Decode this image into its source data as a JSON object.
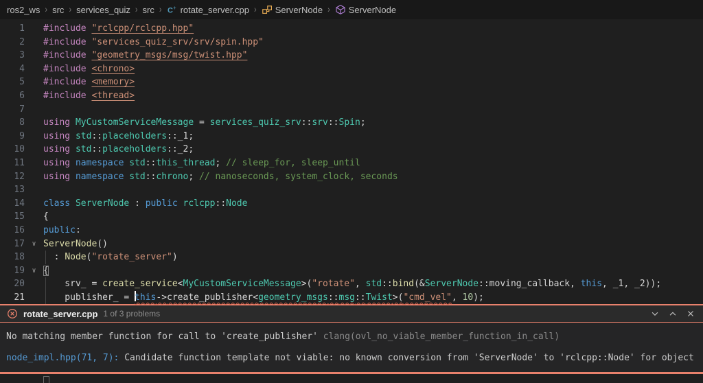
{
  "breadcrumb": {
    "items": [
      {
        "label": "ros2_ws"
      },
      {
        "label": "src"
      },
      {
        "label": "services_quiz"
      },
      {
        "label": "src"
      },
      {
        "label": "rotate_server.cpp",
        "icon": "cpp-file-icon"
      },
      {
        "label": "ServerNode",
        "icon": "class-icon"
      },
      {
        "label": "ServerNode",
        "icon": "method-icon"
      }
    ]
  },
  "editor": {
    "lines": [
      {
        "n": 1,
        "tokens": [
          [
            "pp",
            "#include"
          ],
          [
            "tx",
            " "
          ],
          [
            "st u",
            "\"rclcpp/rclcpp.hpp\""
          ]
        ]
      },
      {
        "n": 2,
        "tokens": [
          [
            "pp",
            "#include"
          ],
          [
            "tx",
            " "
          ],
          [
            "st",
            "\"services_quiz_srv/srv/spin.hpp\""
          ]
        ]
      },
      {
        "n": 3,
        "tokens": [
          [
            "pp",
            "#include"
          ],
          [
            "tx",
            " "
          ],
          [
            "st u",
            "\"geometry_msgs/msg/twist.hpp\""
          ]
        ]
      },
      {
        "n": 4,
        "tokens": [
          [
            "pp",
            "#include"
          ],
          [
            "tx",
            " "
          ],
          [
            "st u",
            "<chrono>"
          ]
        ]
      },
      {
        "n": 5,
        "tokens": [
          [
            "pp",
            "#include"
          ],
          [
            "tx",
            " "
          ],
          [
            "st u",
            "<memory>"
          ]
        ]
      },
      {
        "n": 6,
        "tokens": [
          [
            "pp",
            "#include"
          ],
          [
            "tx",
            " "
          ],
          [
            "st u",
            "<thread>"
          ]
        ]
      },
      {
        "n": 7,
        "tokens": []
      },
      {
        "n": 8,
        "tokens": [
          [
            "pp",
            "using"
          ],
          [
            "tx",
            " "
          ],
          [
            "ty",
            "MyCustomServiceMessage"
          ],
          [
            "tx",
            " = "
          ],
          [
            "ty",
            "services_quiz_srv"
          ],
          [
            "tx",
            "::"
          ],
          [
            "ty",
            "srv"
          ],
          [
            "tx",
            "::"
          ],
          [
            "ty",
            "Spin"
          ],
          [
            "tx",
            ";"
          ]
        ]
      },
      {
        "n": 9,
        "tokens": [
          [
            "pp",
            "using"
          ],
          [
            "tx",
            " "
          ],
          [
            "ty",
            "std"
          ],
          [
            "tx",
            "::"
          ],
          [
            "ty",
            "placeholders"
          ],
          [
            "tx",
            "::_1;"
          ]
        ]
      },
      {
        "n": 10,
        "tokens": [
          [
            "pp",
            "using"
          ],
          [
            "tx",
            " "
          ],
          [
            "ty",
            "std"
          ],
          [
            "tx",
            "::"
          ],
          [
            "ty",
            "placeholders"
          ],
          [
            "tx",
            "::_2;"
          ]
        ]
      },
      {
        "n": 11,
        "tokens": [
          [
            "pp",
            "using"
          ],
          [
            "tx",
            " "
          ],
          [
            "kw",
            "namespace"
          ],
          [
            "tx",
            " "
          ],
          [
            "ty",
            "std"
          ],
          [
            "tx",
            "::"
          ],
          [
            "ty",
            "this_thread"
          ],
          [
            "tx",
            "; "
          ],
          [
            "cm",
            "// sleep_for, sleep_until"
          ]
        ]
      },
      {
        "n": 12,
        "tokens": [
          [
            "pp",
            "using"
          ],
          [
            "tx",
            " "
          ],
          [
            "kw",
            "namespace"
          ],
          [
            "tx",
            " "
          ],
          [
            "ty",
            "std"
          ],
          [
            "tx",
            "::"
          ],
          [
            "ty",
            "chrono"
          ],
          [
            "tx",
            "; "
          ],
          [
            "cm",
            "// nanoseconds, system_clock, seconds"
          ]
        ]
      },
      {
        "n": 13,
        "tokens": []
      },
      {
        "n": 14,
        "tokens": [
          [
            "kw",
            "class"
          ],
          [
            "tx",
            " "
          ],
          [
            "ty",
            "ServerNode"
          ],
          [
            "tx",
            " : "
          ],
          [
            "kw",
            "public"
          ],
          [
            "tx",
            " "
          ],
          [
            "ty",
            "rclcpp"
          ],
          [
            "tx",
            "::"
          ],
          [
            "ty",
            "Node"
          ]
        ]
      },
      {
        "n": 15,
        "tokens": [
          [
            "tx",
            "{"
          ]
        ]
      },
      {
        "n": 16,
        "tokens": [
          [
            "kw",
            "public"
          ],
          [
            "tx",
            ":"
          ]
        ]
      },
      {
        "n": 17,
        "fold": true,
        "tokens": [
          [
            "fn",
            "ServerNode"
          ],
          [
            "tx",
            "()"
          ]
        ]
      },
      {
        "n": 18,
        "guide": true,
        "tokens": [
          [
            "tx",
            "  : "
          ],
          [
            "fn",
            "Node"
          ],
          [
            "tx",
            "("
          ],
          [
            "st",
            "\"rotate_server\""
          ],
          [
            "tx",
            ")"
          ]
        ]
      },
      {
        "n": 19,
        "fold": true,
        "tokens": [
          [
            "tx box",
            "{"
          ]
        ]
      },
      {
        "n": 20,
        "guide": true,
        "tokens": [
          [
            "tx",
            "    srv_ = "
          ],
          [
            "fn",
            "create_service"
          ],
          [
            "tx",
            "<"
          ],
          [
            "ty",
            "MyCustomServiceMessage"
          ],
          [
            "tx",
            ">("
          ],
          [
            "st",
            "\"rotate\""
          ],
          [
            "tx",
            ", "
          ],
          [
            "ty",
            "std"
          ],
          [
            "tx",
            "::"
          ],
          [
            "fn",
            "bind"
          ],
          [
            "tx",
            "(&"
          ],
          [
            "ty",
            "ServerNode"
          ],
          [
            "tx",
            "::moving_callback, "
          ],
          [
            "kw",
            "this"
          ],
          [
            "tx",
            ", _1, _2));"
          ]
        ]
      },
      {
        "n": 21,
        "guide": true,
        "active": true,
        "tokens": [
          [
            "tx",
            "    publisher_ = "
          ],
          [
            "caret kw q",
            "this"
          ],
          [
            "tx q",
            "->"
          ],
          [
            "tx q",
            "create_publisher"
          ],
          [
            "tx q",
            "<"
          ],
          [
            "ty q",
            "geometry_msgs"
          ],
          [
            "tx q",
            "::"
          ],
          [
            "ty q",
            "msg"
          ],
          [
            "tx q",
            "::"
          ],
          [
            "ty q",
            "Twist"
          ],
          [
            "tx q",
            ">("
          ],
          [
            "st q",
            "\"cmd_vel\""
          ],
          [
            "tx",
            ", "
          ],
          [
            "nm",
            "10"
          ],
          [
            "tx",
            ");"
          ]
        ]
      }
    ]
  },
  "problems": {
    "title": "rotate_server.cpp",
    "meta": "1 of 3 problems",
    "messages": [
      {
        "parts": [
          [
            "m-msg",
            "No matching member function for call to 'create_publisher' "
          ],
          [
            "m-src",
            "clang(ovl_no_viable_member_function_in_call)"
          ]
        ]
      },
      {
        "parts": [
          [
            "m-link",
            "node_impl.hpp(71, 7): "
          ],
          [
            "m-msg",
            "Candidate function template not viable: no known conversion from 'ServerNode' to 'rclcpp::Node' for object"
          ]
        ]
      }
    ]
  },
  "colors": {
    "error_accent": "#e8816c",
    "squiggle": "#d6604a",
    "link": "#569cd6",
    "editor_bg": "#1f1f1f",
    "breadcrumb_bg": "#181818"
  }
}
